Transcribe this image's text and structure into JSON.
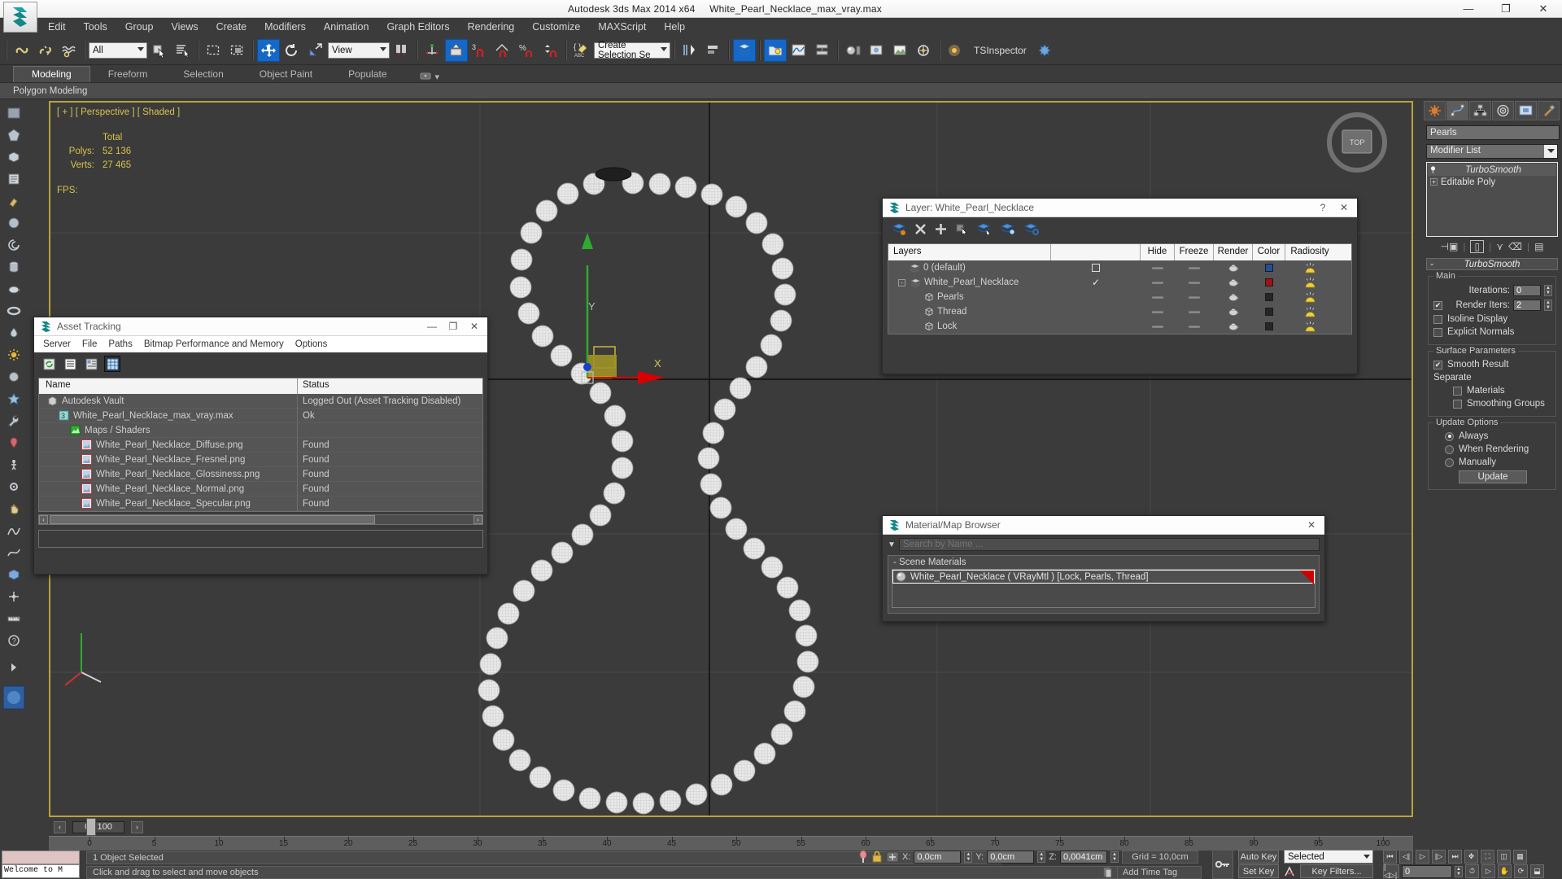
{
  "titlebar": {
    "app_title": "Autodesk 3ds Max  2014 x64",
    "file_title": "White_Pearl_Necklace_max_vray.max",
    "minimize": "—",
    "maximize": "❐",
    "close": "✕"
  },
  "menubar": {
    "items": [
      "Edit",
      "Tools",
      "Group",
      "Views",
      "Create",
      "Modifiers",
      "Animation",
      "Graph Editors",
      "Rendering",
      "Customize",
      "MAXScript",
      "Help"
    ]
  },
  "maintoolbar": {
    "selection_filter": "All",
    "ref_coord_system": "View",
    "named_selection_set": "Create Selection Se",
    "tsinspector": "TSInspector"
  },
  "ribbon": {
    "tabs": [
      "Modeling",
      "Freeform",
      "Selection",
      "Object Paint",
      "Populate"
    ],
    "active_tab": "Modeling",
    "subtitle": "Polygon Modeling"
  },
  "viewport": {
    "label": "[ + ] [ Perspective ] [ Shaded ]",
    "stats_total_header": "Total",
    "polys_label": "Polys:",
    "polys_value": "52 136",
    "verts_label": "Verts:",
    "verts_value": "27 465",
    "fps_label": "FPS:",
    "axis_x": "X",
    "axis_y": "Y",
    "viewcube_top": "TOP"
  },
  "asset_tracking": {
    "title": "Asset Tracking",
    "menu": [
      "Server",
      "File",
      "Paths",
      "Bitmap Performance and Memory",
      "Options"
    ],
    "columns": [
      "Name",
      "Status"
    ],
    "rows": [
      {
        "name": "Autodesk Vault",
        "status": "Logged Out (Asset Tracking Disabled)",
        "indent": 0,
        "icon": "vault-icon"
      },
      {
        "name": "White_Pearl_Necklace_max_vray.max",
        "status": "Ok",
        "indent": 1,
        "icon": "max-file-icon"
      },
      {
        "name": "Maps / Shaders",
        "status": "",
        "indent": 2,
        "icon": "maps-icon"
      },
      {
        "name": "White_Pearl_Necklace_Diffuse.png",
        "status": "Found",
        "indent": 3,
        "icon": "bitmap-icon"
      },
      {
        "name": "White_Pearl_Necklace_Fresnel.png",
        "status": "Found",
        "indent": 3,
        "icon": "bitmap-icon"
      },
      {
        "name": "White_Pearl_Necklace_Glossiness.png",
        "status": "Found",
        "indent": 3,
        "icon": "bitmap-icon"
      },
      {
        "name": "White_Pearl_Necklace_Normal.png",
        "status": "Found",
        "indent": 3,
        "icon": "bitmap-icon"
      },
      {
        "name": "White_Pearl_Necklace_Specular.png",
        "status": "Found",
        "indent": 3,
        "icon": "bitmap-icon"
      }
    ],
    "scroll_left": "‹",
    "scroll_right": "›"
  },
  "layer_window": {
    "title": "Layer: White_Pearl_Necklace",
    "help_btn": "?",
    "close_btn": "✕",
    "columns": [
      "Layers",
      "",
      "Hide",
      "Freeze",
      "Render",
      "Color",
      "Radiosity"
    ],
    "rows": [
      {
        "name": "0 (default)",
        "indent": 1,
        "kind": "layer",
        "current": "box",
        "color": "#20509e",
        "expander": ""
      },
      {
        "name": "White_Pearl_Necklace",
        "indent": 1,
        "kind": "layer",
        "current": "check",
        "color": "#a31015",
        "expander": "-"
      },
      {
        "name": "Pearls",
        "indent": 2,
        "kind": "object",
        "current": "",
        "color": "#262626",
        "expander": ""
      },
      {
        "name": "Thread",
        "indent": 2,
        "kind": "object",
        "current": "",
        "color": "#262626",
        "expander": ""
      },
      {
        "name": "Lock",
        "indent": 2,
        "kind": "object",
        "current": "",
        "color": "#262626",
        "expander": ""
      }
    ]
  },
  "material_browser": {
    "title": "Material/Map Browser",
    "close_btn": "✕",
    "search_placeholder": "Search by Name ...",
    "group_label": "- Scene Materials",
    "items": [
      {
        "label": "White_Pearl_Necklace  ( VRayMtl )  [Lock, Pearls, Thread]"
      }
    ]
  },
  "command_panel": {
    "object_name": "Pearls",
    "modifier_list_label": "Modifier List",
    "modifiers": [
      {
        "label": "TurboSmooth",
        "selected": true
      },
      {
        "label": "Editable Poly",
        "selected": false
      }
    ],
    "rollout": {
      "title": "TurboSmooth",
      "collapse": "-",
      "groups": [
        {
          "title": "Main",
          "fields": [
            {
              "type": "spinner",
              "label": "Iterations:",
              "value": "0"
            },
            {
              "type": "checkspinner",
              "label": "Render Iters:",
              "value": "2",
              "checked": true
            },
            {
              "type": "checkbox",
              "label": "Isoline Display",
              "checked": false
            },
            {
              "type": "checkbox",
              "label": "Explicit Normals",
              "checked": false
            }
          ]
        },
        {
          "title": "Surface Parameters",
          "fields": [
            {
              "type": "checkbox",
              "label": "Smooth Result",
              "checked": true
            },
            {
              "type": "text",
              "label": "Separate"
            },
            {
              "type": "checkbox",
              "label": "Materials",
              "checked": false,
              "indent": true
            },
            {
              "type": "checkbox",
              "label": "Smoothing Groups",
              "checked": false,
              "indent": true
            }
          ]
        },
        {
          "title": "Update Options",
          "fields": [
            {
              "type": "radio",
              "label": "Always",
              "checked": true
            },
            {
              "type": "radio",
              "label": "When Rendering",
              "checked": false
            },
            {
              "type": "radio",
              "label": "Manually",
              "checked": false
            },
            {
              "type": "button",
              "label": "Update"
            }
          ]
        }
      ]
    }
  },
  "timeline": {
    "frame_field": "0 / 100",
    "ticks": [
      0,
      5,
      10,
      15,
      20,
      25,
      30,
      35,
      40,
      45,
      50,
      55,
      60,
      65,
      70,
      75,
      80,
      85,
      90,
      95,
      100
    ]
  },
  "statusbar": {
    "maxlistener_text": "Welcome to M",
    "selection_status": "1 Object Selected",
    "prompt": "Click and drag to select and move objects",
    "x_label": "X:",
    "x_value": "0,0cm",
    "y_label": "Y:",
    "y_value": "0,0cm",
    "z_label": "Z:",
    "z_value": "0,0041cm",
    "grid": "Grid = 10,0cm",
    "add_time_tag": "Add Time Tag",
    "auto_key": "Auto Key",
    "set_key": "Set Key",
    "key_filters": "Key Filters...",
    "key_mode_selected": "Selected",
    "key_frame_value": "0"
  }
}
